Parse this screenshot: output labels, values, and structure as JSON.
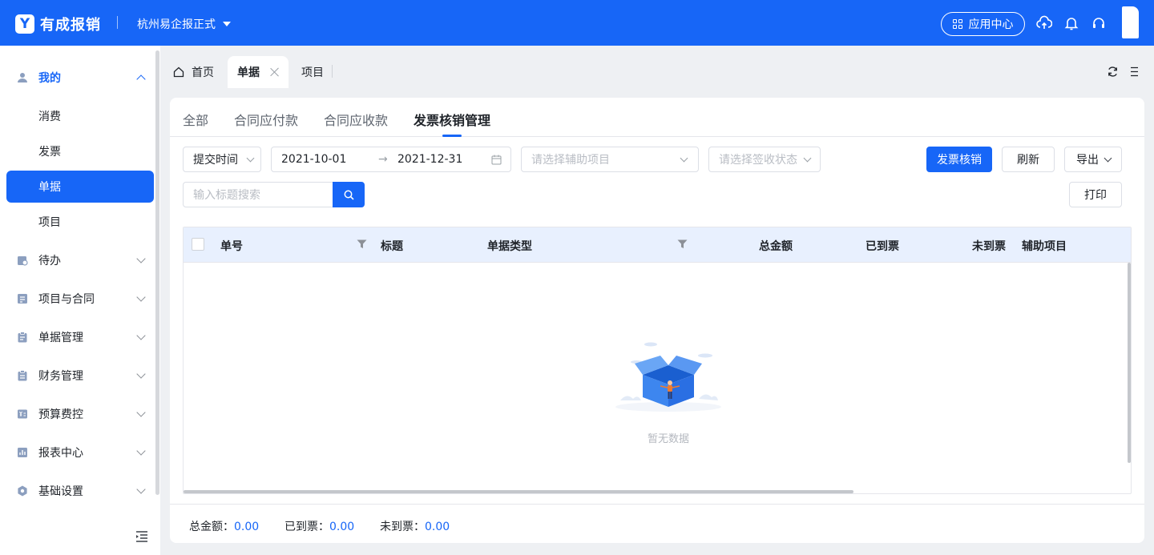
{
  "header": {
    "logo_mark": "Y",
    "app_name": "有成报销",
    "company": "杭州易企报正式",
    "app_center_label": "应用中心"
  },
  "sidebar": {
    "items": [
      {
        "label": "我的",
        "icon": "user-icon"
      },
      {
        "label": "消费"
      },
      {
        "label": "发票"
      },
      {
        "label": "单据"
      },
      {
        "label": "项目"
      },
      {
        "label": "待办",
        "icon": "todo-icon"
      },
      {
        "label": "项目与合同",
        "icon": "contract-icon"
      },
      {
        "label": "单据管理",
        "icon": "clipboard-icon"
      },
      {
        "label": "财务管理",
        "icon": "finance-icon"
      },
      {
        "label": "预算费控",
        "icon": "budget-icon"
      },
      {
        "label": "报表中心",
        "icon": "report-icon"
      },
      {
        "label": "基础设置",
        "icon": "gear-icon"
      }
    ]
  },
  "tabs": [
    {
      "label": "首页"
    },
    {
      "label": "单据"
    },
    {
      "label": "项目"
    }
  ],
  "subtabs": [
    "全部",
    "合同应付款",
    "合同应收款",
    "发票核销管理"
  ],
  "filters": {
    "time_type": "提交时间",
    "date_start": "2021-10-01",
    "date_arrow": "→",
    "date_end": "2021-12-31",
    "aux_project_placeholder": "请选择辅助项目",
    "sign_status_placeholder": "请选择签收状态",
    "search_placeholder": "输入标题搜索"
  },
  "buttons": {
    "verify": "发票核销",
    "refresh": "刷新",
    "export": "导出",
    "print": "打印"
  },
  "table": {
    "columns": [
      "单号",
      "标题",
      "单据类型",
      "总金额",
      "已到票",
      "未到票",
      "辅助项目"
    ],
    "empty_text": "暂无数据"
  },
  "footer": {
    "total_label": "总金额：",
    "total_value": "0.00",
    "received_label": "已到票：",
    "received_value": "0.00",
    "pending_label": "未到票：",
    "pending_value": "0.00"
  }
}
